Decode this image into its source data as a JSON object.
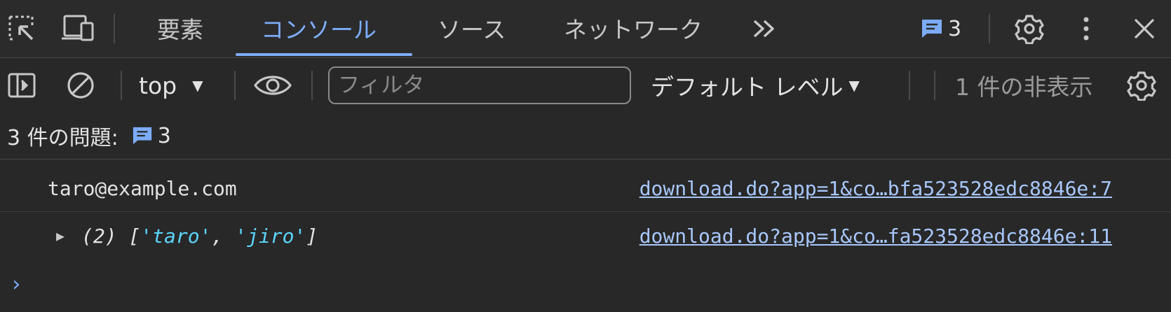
{
  "tabbar": {
    "tabs": [
      {
        "label": "要素",
        "active": false
      },
      {
        "label": "コンソール",
        "active": true
      },
      {
        "label": "ソース",
        "active": false
      },
      {
        "label": "ネットワーク",
        "active": false
      }
    ],
    "more_tabs_icon": "double-chevron-right-icon",
    "issues_count": "3",
    "accent_color": "#7cacf8"
  },
  "toolbar": {
    "context": "top",
    "filter_placeholder": "フィルタ",
    "filter_value": "",
    "levels_label": "デフォルト レベル",
    "hidden_count_label": "1 件の非表示"
  },
  "issues": {
    "label": "3 件の問題:",
    "count": "3"
  },
  "messages": [
    {
      "text": "taro@example.com",
      "source": "download.do?app=1&co…bfa523528edc8846e:7"
    },
    {
      "count": "(2)",
      "items": [
        "'taro'",
        "'jiro'"
      ],
      "source": "download.do?app=1&co…fa523528edc8846e:11"
    }
  ],
  "prompt": {
    "symbol": "›"
  }
}
